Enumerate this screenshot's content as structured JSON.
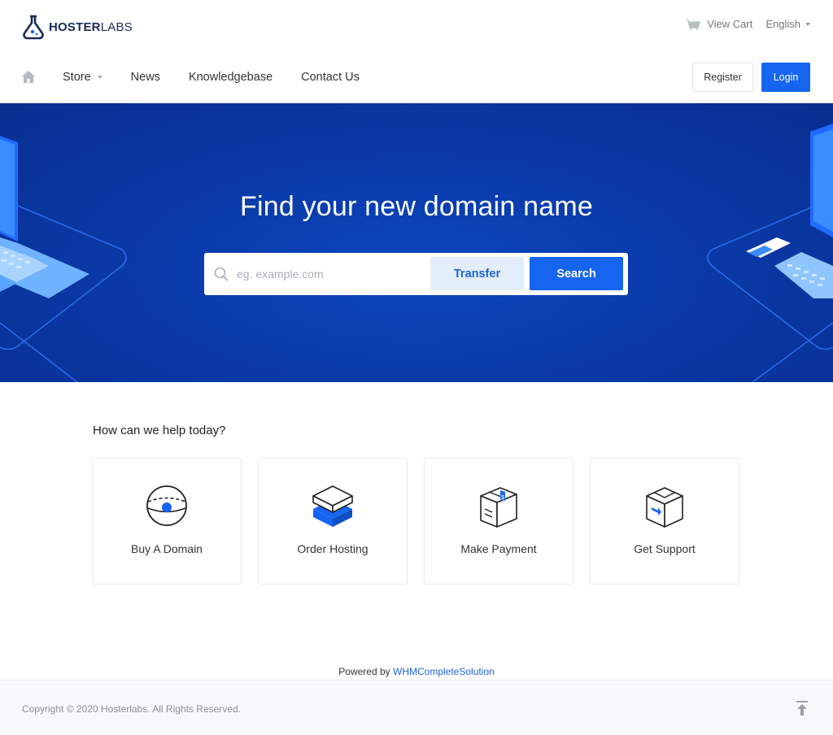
{
  "brand": {
    "name_bold": "HOSTER",
    "name_thin": "LABS"
  },
  "topbar": {
    "cart_label": "View Cart",
    "language": "English"
  },
  "nav": {
    "items": [
      {
        "label": "Store",
        "dropdown": true
      },
      {
        "label": "News",
        "dropdown": false
      },
      {
        "label": "Knowledgebase",
        "dropdown": false
      },
      {
        "label": "Contact Us",
        "dropdown": false
      }
    ],
    "register_label": "Register",
    "login_label": "Login"
  },
  "hero": {
    "title": "Find your new domain name",
    "search_placeholder": "eg. example.com",
    "transfer_label": "Transfer",
    "search_label": "Search"
  },
  "help": {
    "heading": "How can we help today?",
    "cards": [
      {
        "label": "Buy A Domain",
        "icon": "globe-icon"
      },
      {
        "label": "Order Hosting",
        "icon": "server-stack-icon"
      },
      {
        "label": "Make Payment",
        "icon": "payment-box-icon"
      },
      {
        "label": "Get Support",
        "icon": "support-box-icon"
      }
    ]
  },
  "footer": {
    "powered_prefix": "Powered by",
    "powered_link": "WHMCompleteSolution",
    "copyright": "Copyright © 2020 Hosterlabs. All Rights Reserved."
  },
  "colors": {
    "primary": "#1565f0",
    "hero_bg": "#0a3aa8",
    "brand_navy": "#1a2a5c"
  }
}
